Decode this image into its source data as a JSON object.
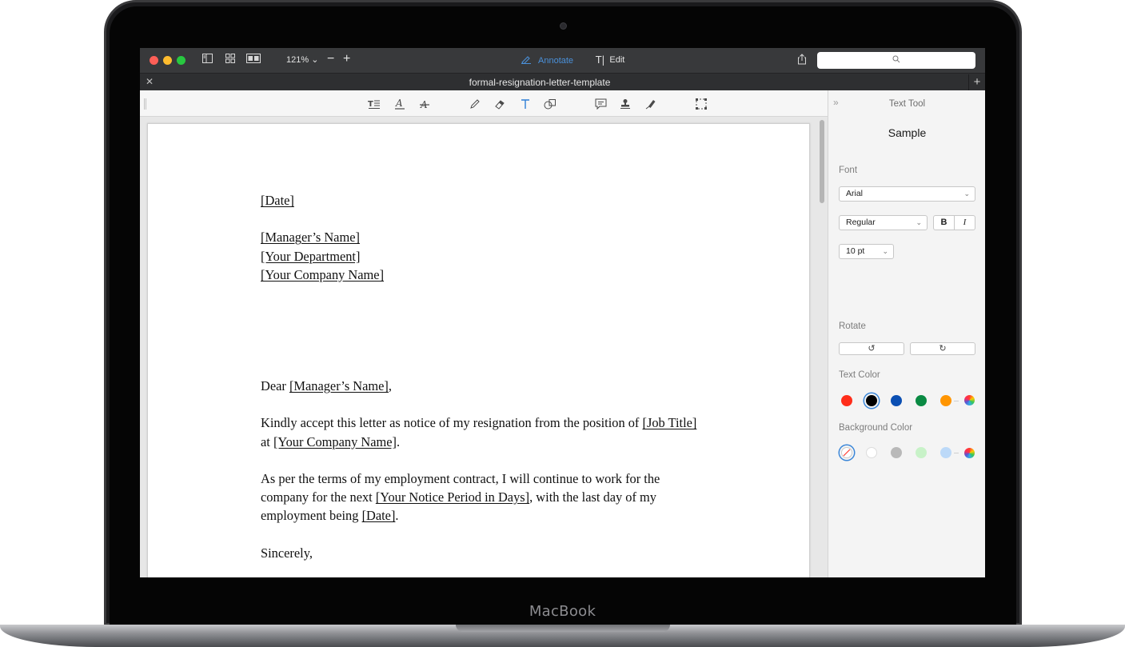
{
  "device": {
    "label": "MacBook"
  },
  "titlebar": {
    "zoom": "121%",
    "modes": {
      "annotate": "Annotate",
      "edit": "Edit"
    },
    "search_placeholder": ""
  },
  "tab": {
    "title": "formal-resignation-letter-template"
  },
  "toolbar": {
    "tools": [
      "text-box-icon",
      "highlight-text-icon",
      "strikethrough-icon",
      "pencil-icon",
      "eraser-icon",
      "text-tool-icon",
      "shapes-icon",
      "note-icon",
      "stamp-icon",
      "signature-icon",
      "selection-icon"
    ],
    "active_tool": "text-tool-icon"
  },
  "letter": {
    "date": "[Date]",
    "manager": "[Manager’s Name]",
    "department": "[Your Department]",
    "company": "[Your Company Name]",
    "salutation_prefix": "Dear ",
    "salutation_name": "[Manager’s Name]",
    "salutation_suffix": ",",
    "p1_a": "Kindly accept this letter as notice of my resignation from the position of ",
    "p1_job": "[Job Title]",
    "p1_b": "at ",
    "p1_company": "[Your Company Name]",
    "p1_end": ".",
    "p2_line1": "As per the terms of my employment contract, I will continue to work for the",
    "p2_a": "company for the next ",
    "p2_notice": "[Your Notice Period in Days]",
    "p2_b": ", with the last day of my",
    "p2_c": "employment being ",
    "p2_date": "[Date]",
    "p2_end": ".",
    "closing": "Sincerely,"
  },
  "panel": {
    "title": "Text Tool",
    "sample": "Sample",
    "font_label": "Font",
    "font_value": "Arial",
    "style_value": "Regular",
    "bold_label": "B",
    "italic_label": "I",
    "size_value": "10 pt",
    "rotate_label": "Rotate",
    "text_color_label": "Text Color",
    "text_colors": [
      "#ff2d1a",
      "#000000",
      "#0b4fb3",
      "#0a8a43",
      "#ff9500"
    ],
    "selected_text_color": "#000000",
    "bg_color_label": "Background Color",
    "bg_colors": [
      "none",
      "#ffffff",
      "#b9b9b9",
      "#c8f2c8",
      "#bcd9f8"
    ]
  }
}
